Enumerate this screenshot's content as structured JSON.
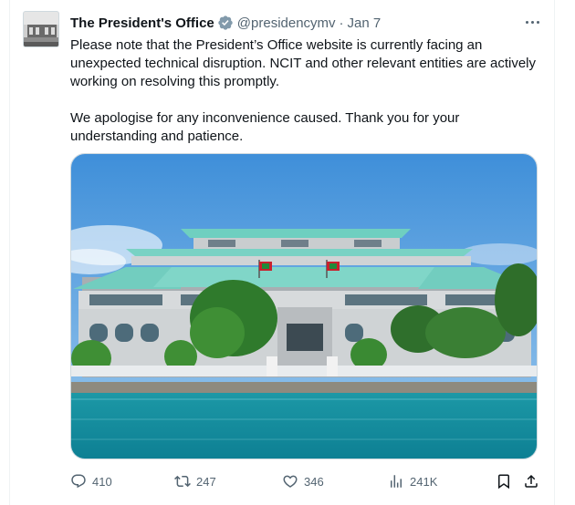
{
  "tweet": {
    "display_name": "The President's Office",
    "handle": "@presidencymv",
    "separator": "·",
    "date": "Jan 7",
    "paragraphs": [
      "Please note that the President’s Office website is currently facing an unexpected technical disruption. NCIT and other relevant entities are actively working on resolving this promptly.",
      "We apologise for any inconvenience caused. Thank you for your understanding and patience."
    ]
  },
  "actions": {
    "replies": "410",
    "retweets": "247",
    "likes": "346",
    "views": "241K"
  },
  "icons": {
    "verified": "verified-badge-icon",
    "more": "more-dots-icon",
    "reply": "reply-icon",
    "retweet": "retweet-icon",
    "like": "heart-icon",
    "views": "views-chart-icon",
    "bookmark": "bookmark-icon",
    "share": "share-icon"
  },
  "colors": {
    "text_primary": "#0f1419",
    "text_secondary": "#536471",
    "verified_badge": "#829aab",
    "border": "#cfd9de"
  }
}
